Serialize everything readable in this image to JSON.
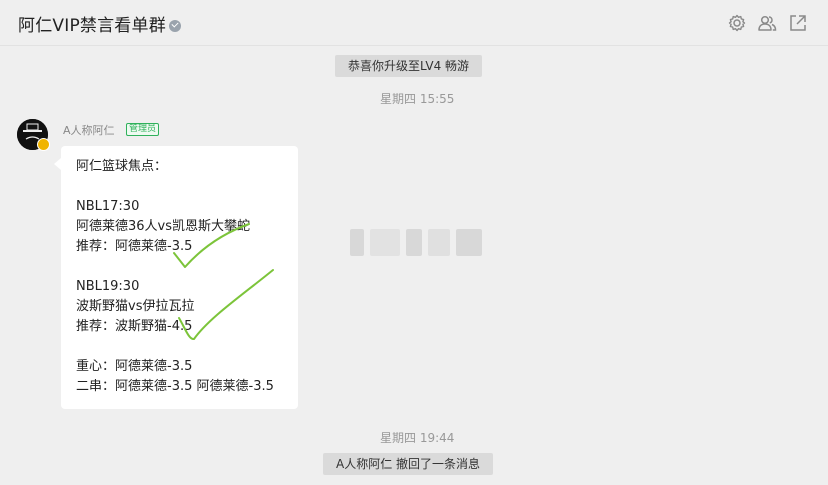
{
  "window": {
    "title": "阿仁VIP禁言看单群",
    "icons": [
      "settings-gear-icon",
      "group-members-icon",
      "open-external-icon"
    ]
  },
  "system": {
    "upgrade_notice": "恭喜你升级至LV4 畅游",
    "recall_notice": "A人称阿仁 撤回了一条消息"
  },
  "timestamps": {
    "first": "星期四 15:55",
    "second": "星期四 19:44"
  },
  "message": {
    "sender": "A人称阿仁",
    "role_tag": "管理员",
    "lines": [
      "阿仁篮球焦点：",
      "NBL17:30",
      "阿德莱德36人vs凯恩斯大攀蛇",
      "推荐：阿德莱德-3.5",
      "NBL19:30",
      "波斯野猫vs伊拉瓦拉",
      "推荐：波斯野猫-4.5",
      "重心：阿德莱德-3.5",
      "二串：阿德莱德-3.5 阿德莱德-3.5"
    ],
    "annotation_color": "#7cc43a"
  },
  "colors": {
    "background": "#efefef",
    "bubble": "#ffffff",
    "admin_tag": "#2fb15b",
    "system_pill": "#dadada",
    "timestamp": "#999999"
  }
}
